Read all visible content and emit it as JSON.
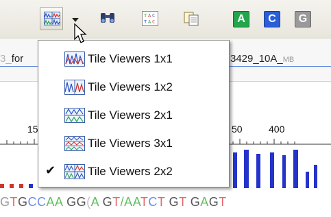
{
  "toolbar": {
    "buttons": [
      {
        "name": "tile-viewers-icon"
      },
      {
        "name": "binoculars-find-icon"
      },
      {
        "name": "sequence-text-icon"
      },
      {
        "name": "copy-pages-icon"
      }
    ],
    "base_buttons": [
      {
        "label": "A",
        "color": "#22a54b"
      },
      {
        "label": "C",
        "color": "#2b5fd9"
      },
      {
        "label": "G",
        "color": "#9a9a9a"
      }
    ]
  },
  "tabs": {
    "left_prefix": "3_",
    "left_text": "for",
    "right_text": "3429_10A_",
    "right_faded": "MB"
  },
  "ruler": {
    "labels": [
      "15",
      "50",
      "400"
    ]
  },
  "sequence": [
    {
      "t": "G",
      "c": "#999999"
    },
    {
      "t": "T",
      "c": "#e06a6a"
    },
    {
      "t": "G",
      "c": "#555555"
    },
    {
      "t": "C",
      "c": "#6c8de6"
    },
    {
      "t": "C",
      "c": "#6c8de6"
    },
    {
      "t": "A",
      "c": "#5fbf5f"
    },
    {
      "t": "A",
      "c": "#5fbf5f"
    },
    {
      "t": " ",
      "c": "#000000"
    },
    {
      "t": "G",
      "c": "#555555"
    },
    {
      "t": "G",
      "c": "#555555"
    },
    {
      "t": "(",
      "c": "#c0c0c0"
    },
    {
      "t": "A",
      "c": "#5fbf5f"
    },
    {
      "t": " ",
      "c": "#000000"
    },
    {
      "t": "G",
      "c": "#555555"
    },
    {
      "t": "T",
      "c": "#e06a6a"
    },
    {
      "t": "/",
      "c": "#5fbf5f"
    },
    {
      "t": "A",
      "c": "#5fbf5f"
    },
    {
      "t": "A",
      "c": "#5fbf5f"
    },
    {
      "t": "T",
      "c": "#e06a6a"
    },
    {
      "t": "C",
      "c": "#6c8de6"
    },
    {
      "t": "T",
      "c": "#e06a6a"
    },
    {
      "t": " ",
      "c": "#000000"
    },
    {
      "t": "G",
      "c": "#555555"
    },
    {
      "t": "T",
      "c": "#e06a6a"
    },
    {
      "t": " ",
      "c": "#000000"
    },
    {
      "t": "G",
      "c": "#555555"
    },
    {
      "t": "A",
      "c": "#5fbf5f"
    },
    {
      "t": "G",
      "c": "#555555"
    },
    {
      "t": "T",
      "c": "#e06a6a"
    }
  ],
  "menu": {
    "items": [
      {
        "label": "Tile Viewers 1x1",
        "checked": false
      },
      {
        "label": "Tile Viewers 1x2",
        "checked": false
      },
      {
        "label": "Tile Viewers 2x1",
        "checked": false
      },
      {
        "label": "Tile Viewers 3x1",
        "checked": false
      },
      {
        "label": "Tile Viewers 2x2",
        "checked": true
      }
    ],
    "check_glyph": "✔"
  }
}
